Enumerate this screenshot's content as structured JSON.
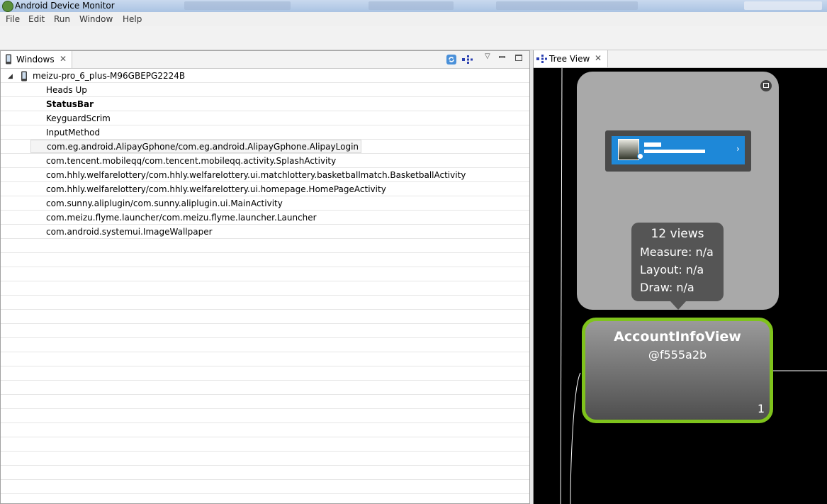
{
  "app": {
    "title": "Android Device Monitor"
  },
  "menu": [
    "File",
    "Edit",
    "Run",
    "Window",
    "Help"
  ],
  "windows_view": {
    "tab_label": "Windows",
    "device": "meizu-pro_6_plus-M96GBEPG2224B",
    "items": [
      "Heads Up",
      "StatusBar",
      "KeyguardScrim",
      "InputMethod",
      "com.eg.android.AlipayGphone/com.eg.android.AlipayGphone.AlipayLogin",
      "com.tencent.mobileqq/com.tencent.mobileqq.activity.SplashActivity",
      "com.hhly.welfarelottery/com.hhly.welfarelottery.ui.matchlottery.basketballmatch.BasketballActivity",
      "com.hhly.welfarelottery/com.hhly.welfarelottery.ui.homepage.HomePageActivity",
      "com.sunny.aliplugin/com.sunny.aliplugin.ui.MainActivity",
      "com.meizu.flyme.launcher/com.meizu.flyme.launcher.Launcher",
      "com.android.systemui.ImageWallpaper"
    ],
    "bold_item": "StatusBar",
    "selected_item": "com.eg.android.AlipayGphone/com.eg.android.AlipayGphone.AlipayLogin"
  },
  "tree_view": {
    "tab_label": "Tree View",
    "tooltip": {
      "views": "12 views",
      "measure": "Measure: n/a",
      "layout": "Layout: n/a",
      "draw": "Draw: n/a"
    },
    "node": {
      "name": "AccountInfoView",
      "id": "@f555a2b",
      "index": "1"
    }
  },
  "icons": {
    "refresh": "refresh-icon",
    "hierarchy": "hierarchy-icon",
    "view_menu": "view-menu-icon",
    "minimize": "minimize-icon",
    "maximize": "maximize-icon",
    "phone": "phone-icon",
    "expand": "expand-arrow-icon",
    "close": "close-icon",
    "collapse": "collapse-icon",
    "chevron": "chevron-right-icon",
    "app": "app-icon"
  },
  "colors": {
    "node_border": "#7fc31c",
    "preview_blue": "#1e88d8",
    "tree_background": "#000000",
    "tooltip_background": "#555555"
  }
}
